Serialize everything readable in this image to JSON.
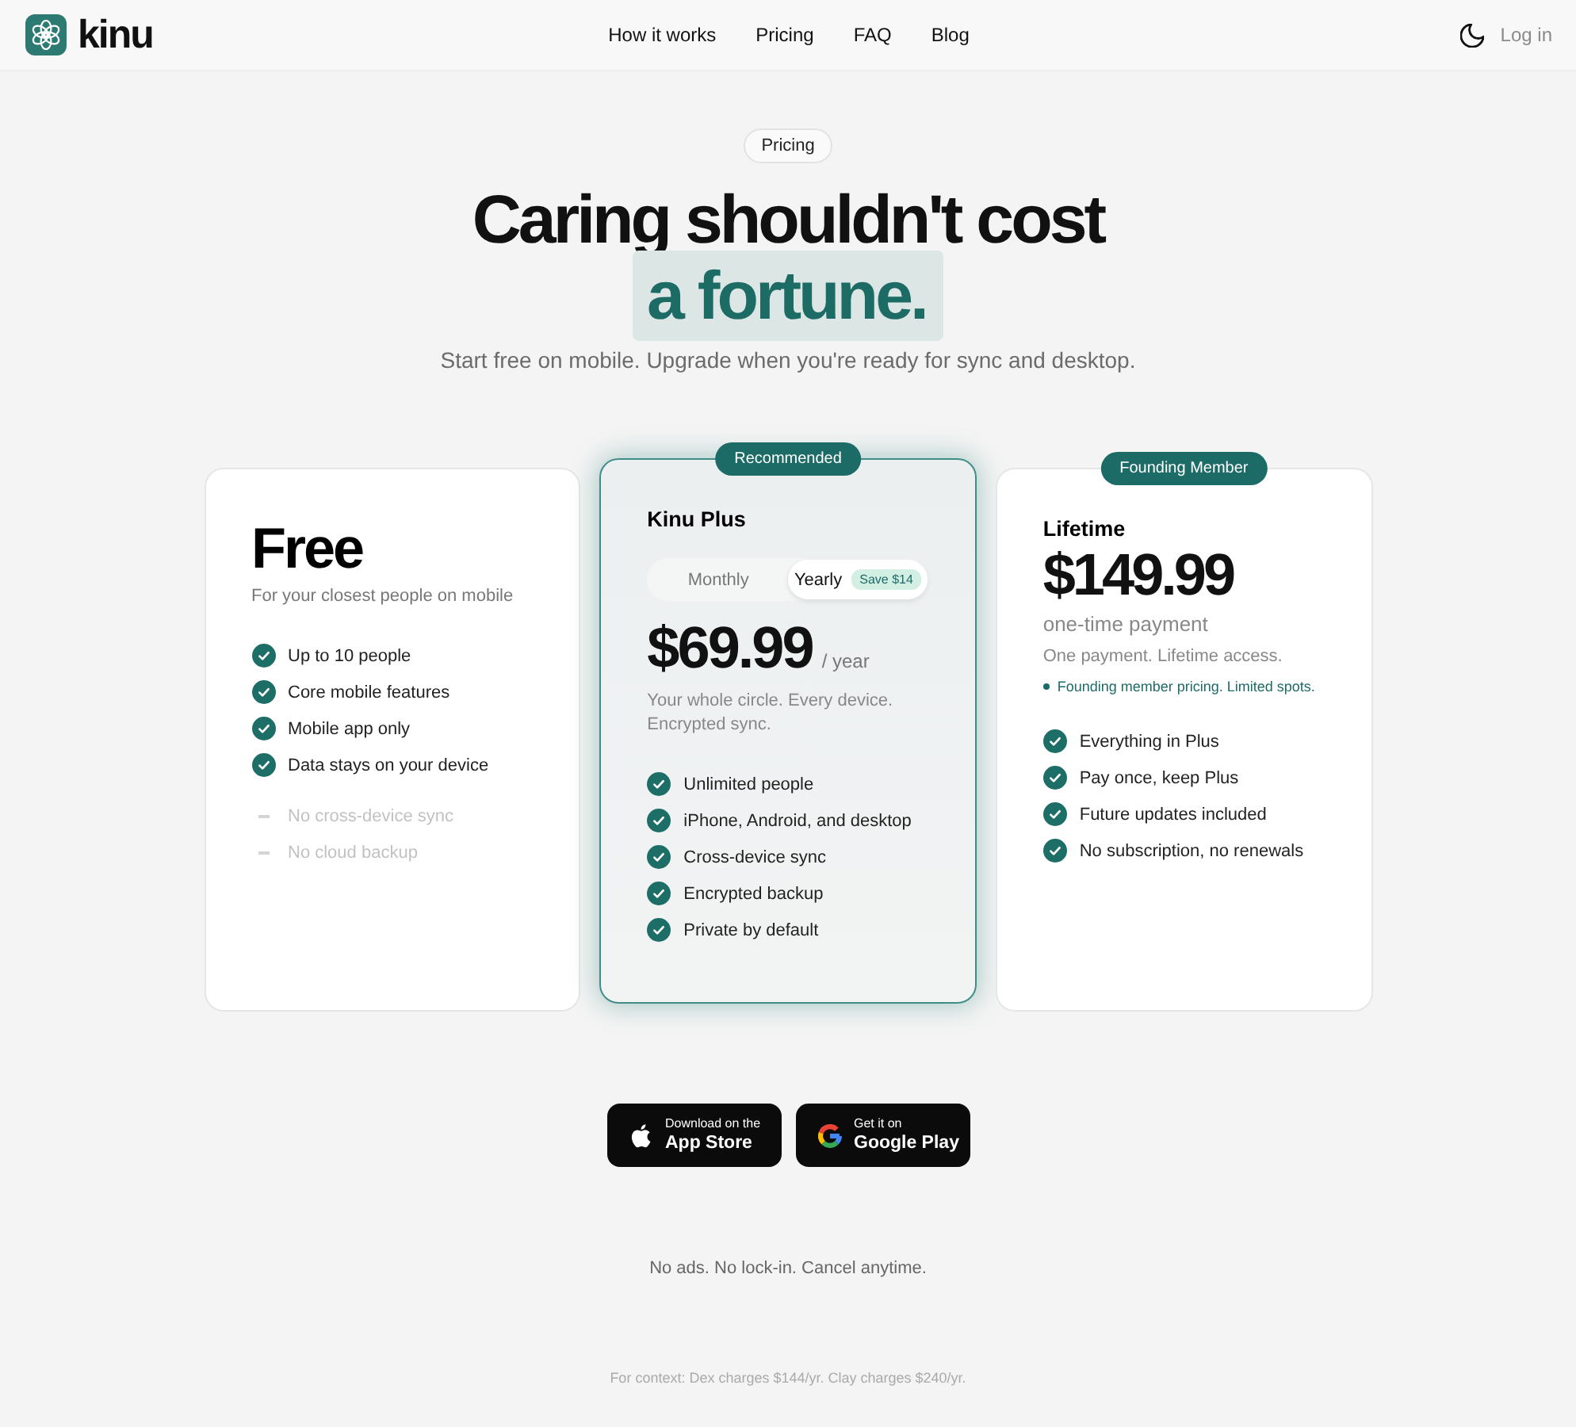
{
  "header": {
    "brand": "kinu",
    "nav": [
      {
        "label": "How it works"
      },
      {
        "label": "Pricing"
      },
      {
        "label": "FAQ"
      },
      {
        "label": "Blog"
      }
    ],
    "login": "Log in"
  },
  "hero": {
    "badge": "Pricing",
    "title": "Caring shouldn't cost",
    "title_highlight": "a fortune.",
    "subtitle": "Start free on mobile. Upgrade when you're ready for sync and desktop."
  },
  "plans": [
    {
      "kind": "free",
      "highlighted": false,
      "name": "Free",
      "tagline": "For your closest people on mobile",
      "features": [
        {
          "text": "Up to 10 people",
          "included": true
        },
        {
          "text": "Core mobile features",
          "included": true
        },
        {
          "text": "Mobile app only",
          "included": true
        },
        {
          "text": "Data stays on your device",
          "included": true
        },
        {
          "text": "No cross-device sync",
          "included": false
        },
        {
          "text": "No cloud backup",
          "included": false
        }
      ]
    },
    {
      "kind": "plus",
      "highlighted": true,
      "badge": "Recommended",
      "name": "Kinu Plus",
      "billing": [
        {
          "label": "Monthly",
          "selected": false
        },
        {
          "label": "Yearly",
          "selected": true,
          "tag": "Save $14"
        }
      ],
      "price": "$69.99",
      "period": "/ year",
      "description": "Your whole circle. Every device. Encrypted sync.",
      "features": [
        {
          "text": "Unlimited people",
          "included": true
        },
        {
          "text": "iPhone, Android, and desktop",
          "included": true
        },
        {
          "text": "Cross-device sync",
          "included": true
        },
        {
          "text": "Encrypted backup",
          "included": true
        },
        {
          "text": "Private by default",
          "included": true
        }
      ]
    },
    {
      "kind": "lifetime",
      "highlighted": false,
      "badge": "Founding Member",
      "name": "Lifetime",
      "price": "$149.99",
      "period": "one-time payment",
      "description": "One payment. Lifetime access.",
      "note": "Founding member pricing. Limited spots.",
      "features": [
        {
          "text": "Everything in Plus",
          "included": true
        },
        {
          "text": "Pay once, keep Plus",
          "included": true
        },
        {
          "text": "Future updates included",
          "included": true
        },
        {
          "text": "No subscription, no renewals",
          "included": true
        }
      ]
    }
  ],
  "stores": [
    {
      "kind": "apple",
      "caption": "Download on the",
      "name": "App Store"
    },
    {
      "kind": "google",
      "caption": "Get it on",
      "name": "Google Play"
    }
  ],
  "guarantee": "No ads. No lock-in. Cancel anytime.",
  "context_note": "For context: Dex charges $144/yr. Clay charges $240/yr."
}
